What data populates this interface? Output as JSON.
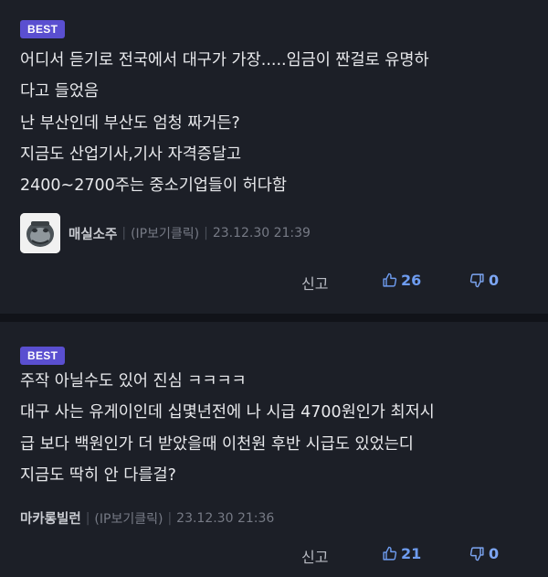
{
  "comments": [
    {
      "badge": "BEST",
      "lines": [
        "어디서 듣기로 전국에서 대구가 가장.....임금이 짠걸로 유명하",
        "다고 들었음",
        "난 부산인데 부산도 엄청 짜거든?",
        "지금도 산업기사,기사 자격증달고",
        "2400~2700주는 중소기업들이 허다함"
      ],
      "nickname": "매실소주",
      "ip_label": "(IP보기클릭)",
      "timestamp": "23.12.30 21:39",
      "report_label": "신고",
      "likes": "26",
      "dislikes": "0",
      "has_avatar": true
    },
    {
      "badge": "BEST",
      "lines": [
        "주작 아닐수도 있어 진심 ㅋㅋㅋㅋ",
        "대구 사는 유게이인데 십몇년전에 나 시급 4700원인가 최저시",
        "급 보다 백원인가 더 받았을때 이천원 후반 시급도 있었는디",
        "지금도 딱히 안 다를걸?"
      ],
      "nickname": "마카롱빌런",
      "ip_label": "(IP보기클릭)",
      "timestamp": "23.12.30 21:36",
      "report_label": "신고",
      "likes": "21",
      "dislikes": "0",
      "has_avatar": false
    }
  ],
  "colors": {
    "background": "#1c1f27",
    "badge": "#5a4fd0",
    "like": "#6e9cf0",
    "text": "#e8e9ec",
    "meta": "#767a85"
  },
  "icons": {
    "like": "thumbs-up-icon",
    "dislike": "thumbs-down-icon"
  }
}
